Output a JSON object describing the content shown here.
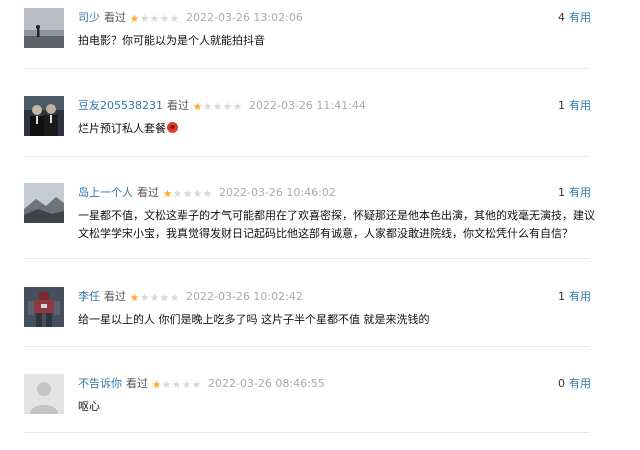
{
  "comments": [
    {
      "username": "司少",
      "watched": "看过",
      "rating": 1,
      "time": "2022-03-26 13:02:06",
      "useful_count": "4",
      "useful_label": "有用",
      "text": "拍电影？你可能以为是个人就能拍抖音",
      "has_emoji": false
    },
    {
      "username": "豆友205538231",
      "watched": "看过",
      "rating": 1,
      "time": "2022-03-26 11:41:44",
      "useful_count": "1",
      "useful_label": "有用",
      "text": "烂片预订私人套餐",
      "has_emoji": true
    },
    {
      "username": "岛上一个人",
      "watched": "看过",
      "rating": 1,
      "time": "2022-03-26 10:46:02",
      "useful_count": "1",
      "useful_label": "有用",
      "text": "一星都不值，文松这辈子的才气可能都用在了欢喜密探，怀疑那还是他本色出演，其他的戏毫无演技，建议文松学学宋小宝，我真觉得发财日记起码比他这部有诚意，人家都没敢进院线，你文松凭什么有自信？",
      "has_emoji": false
    },
    {
      "username": "李任",
      "watched": "看过",
      "rating": 1,
      "time": "2022-03-26 10:02:42",
      "useful_count": "1",
      "useful_label": "有用",
      "text": "给一星以上的人 你们是晚上吃多了吗 这片子半个星都不值 就是来洗钱的",
      "has_emoji": false
    },
    {
      "username": "不告诉你",
      "watched": "看过",
      "rating": 1,
      "time": "2022-03-26 08:46:55",
      "useful_count": "0",
      "useful_label": "有用",
      "text": "呕心",
      "has_emoji": false
    }
  ],
  "colors": {
    "link": "#3377aa",
    "star_on": "#ffac2d",
    "star_off": "#d9d9d9"
  },
  "avatars": [
    "silhouette-coast",
    "two-men-suits",
    "mountain-landscape",
    "robot-figure",
    "default-avatar"
  ]
}
